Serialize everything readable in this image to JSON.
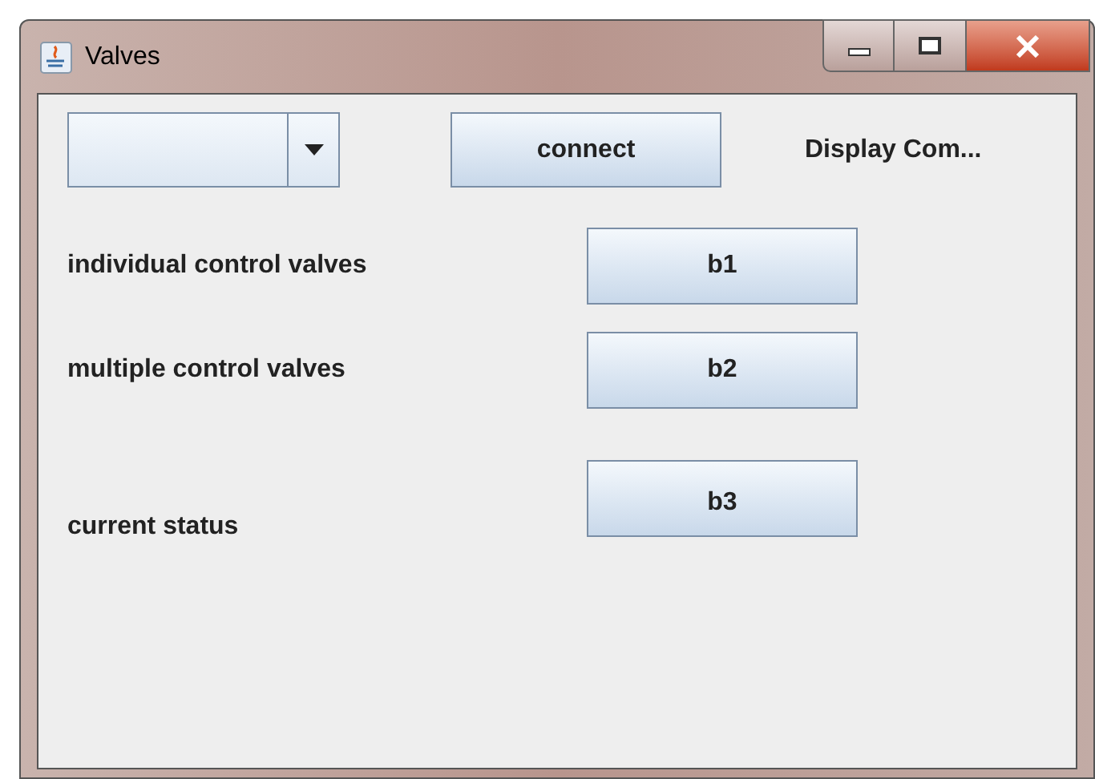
{
  "window": {
    "title": "Valves"
  },
  "toolbar": {
    "connect_button": "connect",
    "display_label": "Display Com..."
  },
  "rows": [
    {
      "label": "individual control valves",
      "button": "b1"
    },
    {
      "label": "multiple control valves",
      "button": "b2"
    },
    {
      "label": "current status",
      "button": "b3"
    }
  ]
}
